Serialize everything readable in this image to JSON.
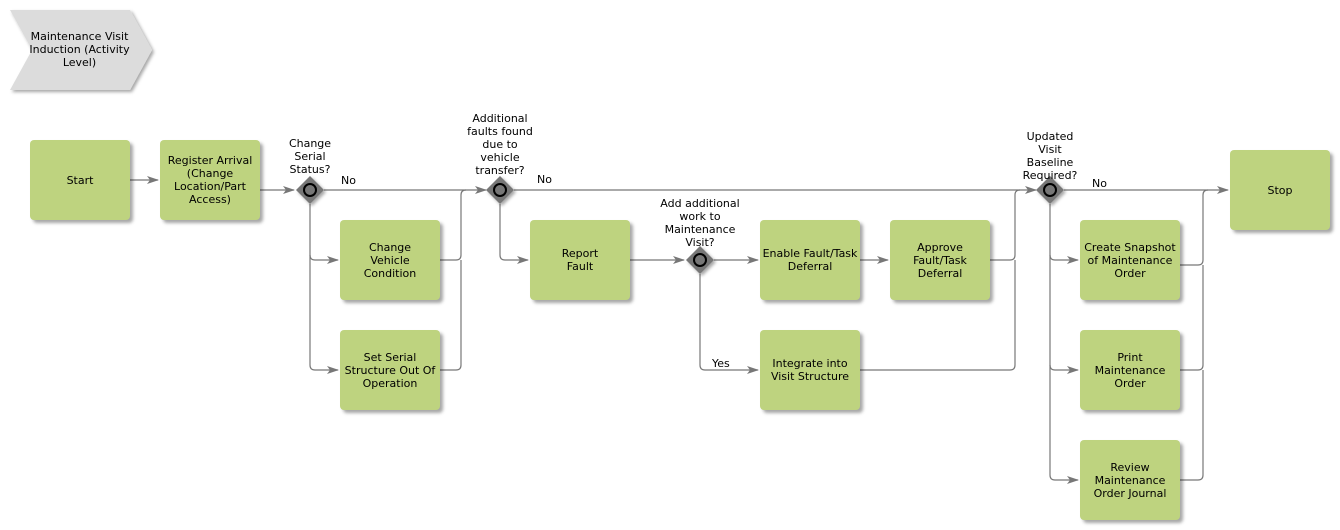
{
  "header": {
    "title": "Maintenance Visit Induction (Activity Level)"
  },
  "colors": {
    "task_fill": "#bed37f",
    "gateway_fill": "#777777",
    "line": "#777777",
    "header_fill": "#dcdcdc"
  },
  "tasks": {
    "start": "Start",
    "register_arrival": "Register Arrival (Change Location/Part Access)",
    "change_vehicle_condition": "Change Vehicle Condition",
    "set_serial_structure": "Set Serial Structure Out Of Operation",
    "report_fault": "Report Fault",
    "enable_deferral": "Enable Fault/Task Deferral",
    "approve_deferral": "Approve Fault/Task Deferral",
    "integrate_visit": "Integrate into Visit Structure",
    "create_snapshot": "Create Snapshot of Maintenance Order",
    "print_order": "Print Maintenance Order",
    "review_journal": "Review Maintenance Order Journal",
    "stop": "Stop"
  },
  "gateways": {
    "change_serial_status": "Change Serial Status?",
    "additional_faults": "Additional faults found due to vehicle transfer?",
    "add_work": "Add additional work to Maintenance Visit?",
    "updated_baseline": "Updated Visit Baseline Required?"
  },
  "flow_labels": {
    "g1_no": "No",
    "g2_no": "No",
    "g3_yes": "Yes",
    "g4_no": "No"
  }
}
